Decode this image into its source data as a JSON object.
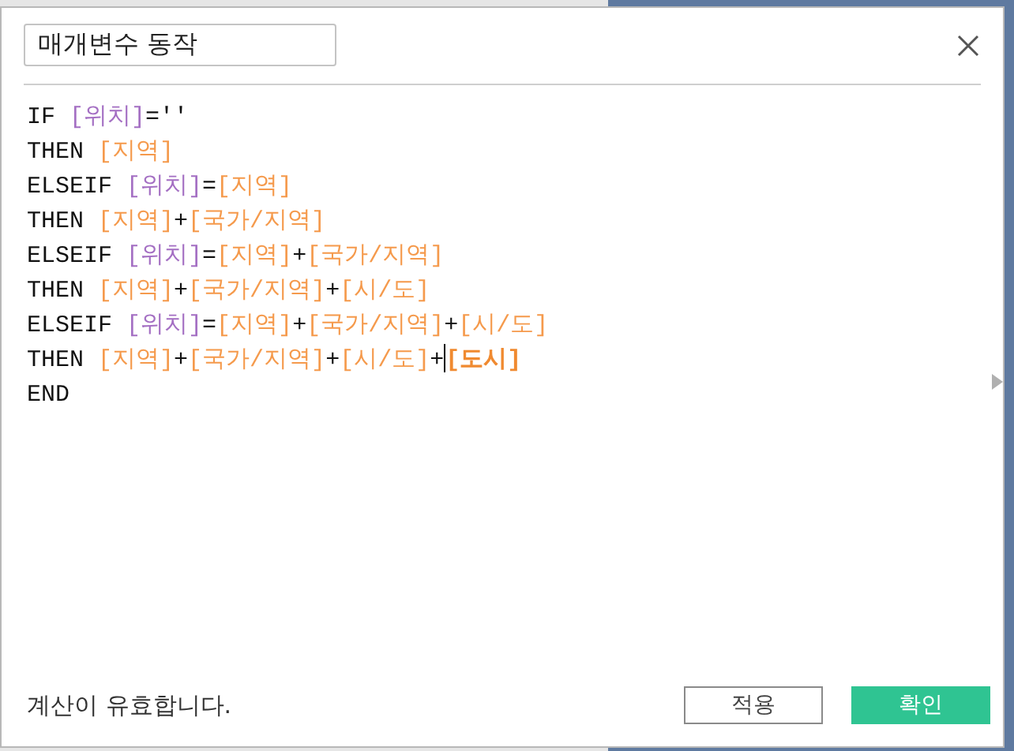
{
  "dialog": {
    "title": "매개변수 동작"
  },
  "code_lines": [
    [
      {
        "kind": "keyword",
        "text": "IF "
      },
      {
        "kind": "param",
        "text": "[위치]"
      },
      {
        "kind": "op",
        "text": "=''"
      }
    ],
    [
      {
        "kind": "keyword",
        "text": "THEN "
      },
      {
        "kind": "field",
        "text": "[지역]"
      }
    ],
    [
      {
        "kind": "keyword",
        "text": "ELSEIF "
      },
      {
        "kind": "param",
        "text": "[위치]"
      },
      {
        "kind": "op",
        "text": "="
      },
      {
        "kind": "field",
        "text": "[지역]"
      }
    ],
    [
      {
        "kind": "keyword",
        "text": "THEN "
      },
      {
        "kind": "field",
        "text": "[지역]"
      },
      {
        "kind": "op",
        "text": "+"
      },
      {
        "kind": "field",
        "text": "[국가/지역]"
      }
    ],
    [
      {
        "kind": "keyword",
        "text": "ELSEIF "
      },
      {
        "kind": "param",
        "text": "[위치]"
      },
      {
        "kind": "op",
        "text": "="
      },
      {
        "kind": "field",
        "text": "[지역]"
      },
      {
        "kind": "op",
        "text": "+"
      },
      {
        "kind": "field",
        "text": "[국가/지역]"
      }
    ],
    [
      {
        "kind": "keyword",
        "text": "THEN "
      },
      {
        "kind": "field",
        "text": "[지역]"
      },
      {
        "kind": "op",
        "text": "+"
      },
      {
        "kind": "field",
        "text": "[국가/지역]"
      },
      {
        "kind": "op",
        "text": "+"
      },
      {
        "kind": "field",
        "text": "[시/도]"
      }
    ],
    [
      {
        "kind": "keyword",
        "text": "ELSEIF "
      },
      {
        "kind": "param",
        "text": "[위치]"
      },
      {
        "kind": "op",
        "text": "="
      },
      {
        "kind": "field",
        "text": "[지역]"
      },
      {
        "kind": "op",
        "text": "+"
      },
      {
        "kind": "field",
        "text": "[국가/지역]"
      },
      {
        "kind": "op",
        "text": "+"
      },
      {
        "kind": "field",
        "text": "[시/도]"
      }
    ],
    [
      {
        "kind": "keyword",
        "text": "THEN "
      },
      {
        "kind": "field",
        "text": "[지역]"
      },
      {
        "kind": "op",
        "text": "+"
      },
      {
        "kind": "field",
        "text": "[국가/지역]"
      },
      {
        "kind": "op",
        "text": "+"
      },
      {
        "kind": "field",
        "text": "[시/도]"
      },
      {
        "kind": "op",
        "text": "+"
      },
      {
        "kind": "caret"
      },
      {
        "kind": "field_bold",
        "text": "[도시]"
      }
    ],
    [
      {
        "kind": "keyword",
        "text": "END"
      }
    ]
  ],
  "status": "계산이 유효합니다.",
  "buttons": [
    {
      "label": "적용",
      "kind": "secondary"
    },
    {
      "label": "확인",
      "kind": "primary"
    }
  ]
}
